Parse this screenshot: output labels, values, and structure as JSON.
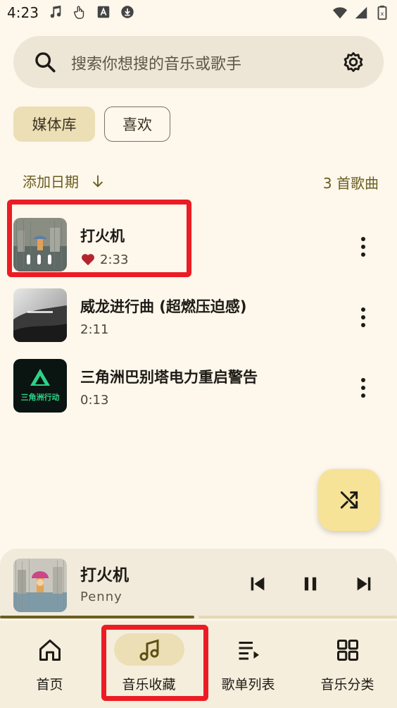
{
  "status": {
    "time": "4:23"
  },
  "search": {
    "placeholder": "搜索你想搜的音乐或歌手"
  },
  "chips": {
    "library": "媒体库",
    "favorites": "喜欢"
  },
  "sort": {
    "label": "添加日期",
    "count": "3 首歌曲"
  },
  "songs": [
    {
      "title": "打火机",
      "duration": "2:33",
      "favorited": true
    },
    {
      "title": "威龙进行曲 (超燃压迫感)",
      "duration": "2:11",
      "favorited": false
    },
    {
      "title": "三角洲巴别塔电力重启警告",
      "duration": "0:13",
      "favorited": false
    }
  ],
  "cover_text": {
    "song2": "三角洲行动"
  },
  "now_playing": {
    "title": "打火机",
    "artist": "Penny",
    "progress": 0.49
  },
  "nav": [
    {
      "label": "首页",
      "icon": "home-icon"
    },
    {
      "label": "音乐收藏",
      "icon": "music-note-icon",
      "active": true
    },
    {
      "label": "歌单列表",
      "icon": "playlist-icon"
    },
    {
      "label": "音乐分类",
      "icon": "grid-icon"
    }
  ],
  "colors": {
    "accent": "#6b5d1e",
    "background": "#fdf7ec",
    "highlight": "#ec1c24",
    "heart": "#b3262e",
    "fab": "#f6e397"
  }
}
